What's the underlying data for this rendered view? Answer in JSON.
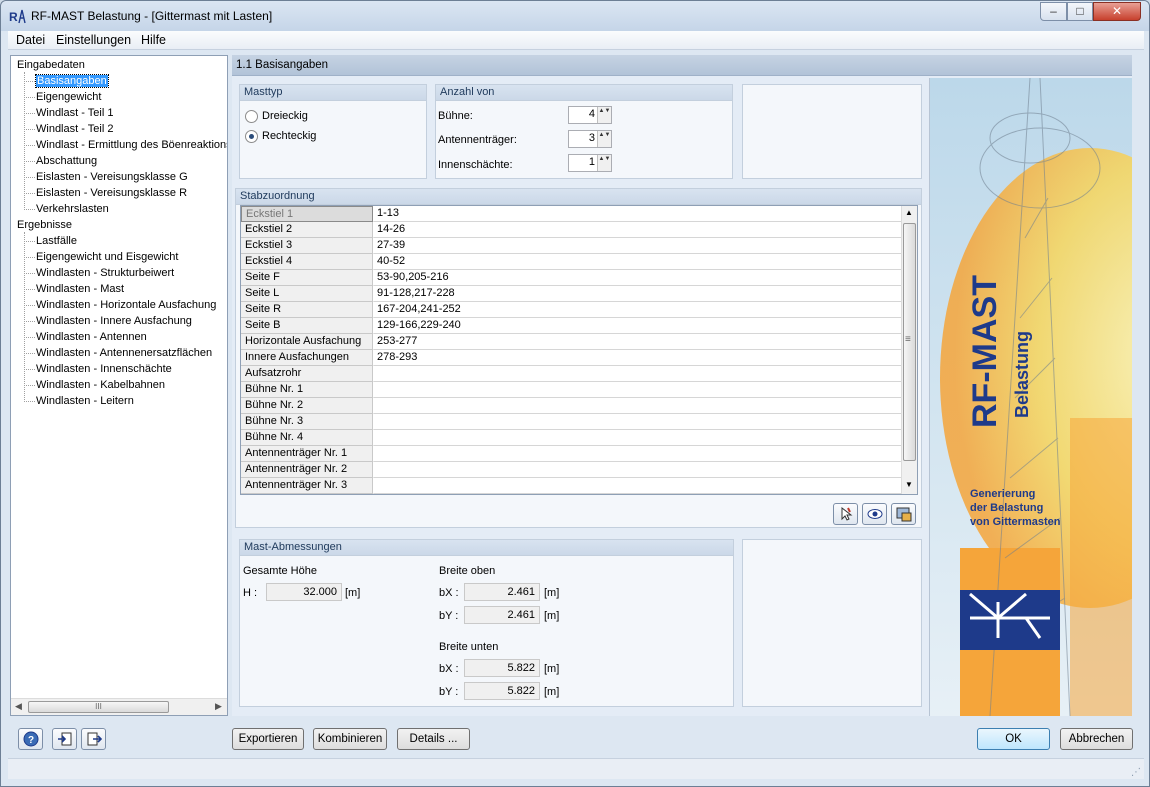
{
  "window": {
    "title": "RF-MAST Belastung - [Gittermast mit Lasten]",
    "min_glyph": "–",
    "max_glyph": "□",
    "close_glyph": "✕"
  },
  "menu": {
    "file": "Datei",
    "settings": "Einstellungen",
    "help": "Hilfe"
  },
  "tree": {
    "input_root": "Eingabedaten",
    "input_items": [
      "Basisangaben",
      "Eigengewicht",
      "Windlast - Teil 1",
      "Windlast - Teil 2",
      "Windlast - Ermittlung des Böenreaktionsfa",
      "Abschattung",
      "Eislasten - Vereisungsklasse G",
      "Eislasten - Vereisungsklasse R",
      "Verkehrslasten"
    ],
    "results_root": "Ergebnisse",
    "result_items": [
      "Lastfälle",
      "Eigengewicht und Eisgewicht",
      "Windlasten - Strukturbeiwert",
      "Windlasten - Mast",
      "Windlasten - Horizontale Ausfachung",
      "Windlasten - Innere Ausfachung",
      "Windlasten - Antennen",
      "Windlasten - Antennenersatzflächen",
      "Windlasten - Innenschächte",
      "Windlasten - Kabelbahnen",
      "Windlasten - Leitern"
    ],
    "scroll_left": "◀",
    "scroll_right": "▶",
    "scroll_grip": "III"
  },
  "main": {
    "title": "1.1 Basisangaben"
  },
  "masttyp": {
    "title": "Masttyp",
    "option1": "Dreieckig",
    "option2": "Rechteckig",
    "selected": "Rechteckig"
  },
  "anzahl": {
    "title": "Anzahl von",
    "buehne_label": "Bühne:",
    "buehne_value": "4",
    "antennen_label": "Antennenträger:",
    "antennen_value": "3",
    "innen_label": "Innenschächte:",
    "innen_value": "1",
    "spin_glyph": "▲▼"
  },
  "stab": {
    "title": "Stabzuordnung",
    "rows": [
      {
        "name": "Eckstiel 1",
        "value": "1-13"
      },
      {
        "name": "Eckstiel 2",
        "value": "14-26"
      },
      {
        "name": "Eckstiel 3",
        "value": "27-39"
      },
      {
        "name": "Eckstiel 4",
        "value": "40-52"
      },
      {
        "name": "Seite F",
        "value": "53-90,205-216"
      },
      {
        "name": "Seite L",
        "value": "91-128,217-228"
      },
      {
        "name": "Seite R",
        "value": "167-204,241-252"
      },
      {
        "name": "Seite B",
        "value": "129-166,229-240"
      },
      {
        "name": "Horizontale Ausfachung",
        "value": "253-277"
      },
      {
        "name": "Innere Ausfachungen",
        "value": "278-293"
      },
      {
        "name": "Aufsatzrohr",
        "value": ""
      },
      {
        "name": "Bühne Nr. 1",
        "value": ""
      },
      {
        "name": "Bühne Nr. 2",
        "value": ""
      },
      {
        "name": "Bühne Nr. 3",
        "value": ""
      },
      {
        "name": "Bühne Nr. 4",
        "value": ""
      },
      {
        "name": "Antennenträger Nr. 1",
        "value": ""
      },
      {
        "name": "Antennenträger Nr. 2",
        "value": ""
      },
      {
        "name": "Antennenträger Nr. 3",
        "value": ""
      }
    ],
    "scroll_up": "▲",
    "scroll_down": "▼",
    "scroll_grip": "≡"
  },
  "mast": {
    "title": "Mast-Abmessungen",
    "hoehe_title": "Gesamte Höhe",
    "h_label": "H :",
    "h_value": "32.000",
    "h_unit": "[m]",
    "oben_title": "Breite oben",
    "bx_label": "bX :",
    "bx_oben": "2.461",
    "by_label": "bY :",
    "by_oben": "2.461",
    "unten_title": "Breite unten",
    "bx_unten": "5.822",
    "by_unten": "5.822",
    "unit": "[m]"
  },
  "side_image": {
    "title": "RF-MAST",
    "subtitle": "Belastung",
    "caption_l1": "Generierung",
    "caption_l2": "der Belastung",
    "caption_l3": "von Gittermasten"
  },
  "buttons": {
    "exportieren": "Exportieren",
    "kombinieren": "Kombinieren ...",
    "details": "Details ...",
    "ok": "OK",
    "abbrechen": "Abbrechen"
  },
  "icons": {
    "help": "help-icon",
    "import": "import-icon",
    "export": "export-icon",
    "select": "select-members-icon",
    "view": "eye-icon",
    "display": "display-icon"
  },
  "colors": {
    "accent": "#3399ff",
    "header": "#b2c3d8",
    "side_blue": "#1e3a8a",
    "side_orange": "#f5a53a"
  }
}
